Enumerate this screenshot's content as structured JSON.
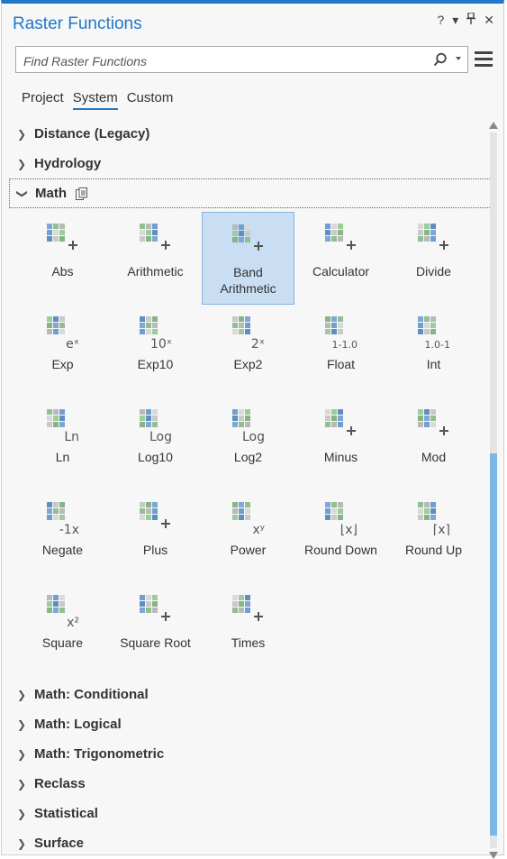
{
  "window": {
    "title": "Raster Functions",
    "help": "?",
    "menu_caret": "▾",
    "pin": "📌",
    "close": "✕"
  },
  "search": {
    "placeholder": "Find Raster Functions",
    "value": ""
  },
  "tabs": [
    {
      "label": "Project",
      "active": false
    },
    {
      "label": "System",
      "active": true
    },
    {
      "label": "Custom",
      "active": false
    }
  ],
  "categories_before": [
    {
      "label": "Distance (Legacy)"
    },
    {
      "label": "Hydrology"
    }
  ],
  "open_category": {
    "label": "Math"
  },
  "tools": [
    {
      "label": "Abs",
      "icon": "abs-icon"
    },
    {
      "label": "Arithmetic",
      "icon": "arithmetic-icon"
    },
    {
      "label": "Band Arithmetic",
      "icon": "band-arithmetic-icon",
      "selected": true
    },
    {
      "label": "Calculator",
      "icon": "calculator-icon"
    },
    {
      "label": "Divide",
      "icon": "divide-icon"
    },
    {
      "label": "Exp",
      "icon": "exp-icon",
      "glyph": "eˣ"
    },
    {
      "label": "Exp10",
      "icon": "exp10-icon",
      "glyph": "10ˣ"
    },
    {
      "label": "Exp2",
      "icon": "exp2-icon",
      "glyph": "2ˣ"
    },
    {
      "label": "Float",
      "icon": "float-icon",
      "glyph": "1-1.0"
    },
    {
      "label": "Int",
      "icon": "int-icon",
      "glyph": "1.0-1"
    },
    {
      "label": "Ln",
      "icon": "ln-icon",
      "glyph": "Ln"
    },
    {
      "label": "Log10",
      "icon": "log10-icon",
      "glyph": "Log"
    },
    {
      "label": "Log2",
      "icon": "log2-icon",
      "glyph": "Log"
    },
    {
      "label": "Minus",
      "icon": "minus-icon"
    },
    {
      "label": "Mod",
      "icon": "mod-icon"
    },
    {
      "label": "Negate",
      "icon": "negate-icon",
      "glyph": "-1x"
    },
    {
      "label": "Plus",
      "icon": "plus-icon"
    },
    {
      "label": "Power",
      "icon": "power-icon",
      "glyph": "xʸ"
    },
    {
      "label": "Round Down",
      "icon": "round-down-icon",
      "glyph": "⌊x⌋"
    },
    {
      "label": "Round Up",
      "icon": "round-up-icon",
      "glyph": "⌈x⌉"
    },
    {
      "label": "Square",
      "icon": "square-icon",
      "glyph": "x²"
    },
    {
      "label": "Square Root",
      "icon": "square-root-icon"
    },
    {
      "label": "Times",
      "icon": "times-icon"
    }
  ],
  "categories_after": [
    {
      "label": "Math: Conditional"
    },
    {
      "label": "Math: Logical"
    },
    {
      "label": "Math: Trigonometric"
    },
    {
      "label": "Reclass"
    },
    {
      "label": "Statistical"
    },
    {
      "label": "Surface"
    }
  ],
  "colors": {
    "accent": "#1f78c8",
    "selected_bg": "#c9def2",
    "scroll_thumb": "#7ab6e6"
  }
}
